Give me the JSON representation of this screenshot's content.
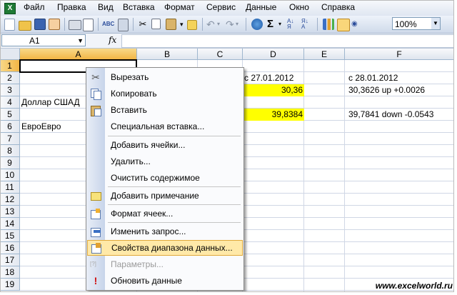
{
  "menubar": {
    "items": [
      "Файл",
      "Правка",
      "Вид",
      "Вставка",
      "Формат",
      "Сервис",
      "Данные",
      "Окно",
      "Справка"
    ]
  },
  "toolbar": {
    "zoom": "100%"
  },
  "formula_bar": {
    "name_box": "A1",
    "fx_label": "fx",
    "formula": ""
  },
  "columns": [
    "A",
    "B",
    "C",
    "D",
    "E",
    "F"
  ],
  "rows": [
    "1",
    "2",
    "3",
    "4",
    "5",
    "6",
    "7",
    "8",
    "9",
    "10",
    "11",
    "12",
    "13",
    "14",
    "15",
    "16",
    "17",
    "18",
    "19"
  ],
  "cells": {
    "D2": "с 27.01.2012",
    "F2": "с 28.01.2012",
    "D3": "30,36",
    "F3": "30,3626 up +0.0026",
    "A4": "Доллар США Доллар США",
    "D5": "39,8384",
    "F5": "39,7841 down -0.0543",
    "A6": "ЕвроЕвро"
  },
  "a4_visible": "Доллар США",
  "a4_tail": "Д",
  "context_menu": {
    "items": [
      {
        "label": "Вырезать",
        "icon": "scissors-icon",
        "enabled": true
      },
      {
        "label": "Копировать",
        "icon": "copy-icon",
        "enabled": true
      },
      {
        "label": "Вставить",
        "icon": "paste-icon",
        "enabled": true
      },
      {
        "label": "Специальная вставка...",
        "icon": "",
        "enabled": true
      },
      {
        "label": "Добавить ячейки...",
        "icon": "",
        "enabled": true
      },
      {
        "label": "Удалить...",
        "icon": "",
        "enabled": true
      },
      {
        "label": "Очистить содержимое",
        "icon": "",
        "enabled": true
      },
      {
        "label": "Добавить примечание",
        "icon": "comment-icon",
        "enabled": true
      },
      {
        "label": "Формат ячеек...",
        "icon": "format-cells-icon",
        "enabled": true
      },
      {
        "label": "Изменить запрос...",
        "icon": "edit-query-icon",
        "enabled": true
      },
      {
        "label": "Свойства диапазона данных...",
        "icon": "data-range-properties-icon",
        "enabled": true,
        "highlighted": true
      },
      {
        "label": "Параметры...",
        "icon": "parameters-icon",
        "enabled": false
      },
      {
        "label": "Обновить данные",
        "icon": "refresh-data-icon",
        "enabled": true
      }
    ]
  },
  "watermark": "www.excelworld.ru",
  "colors": {
    "highlight_cell": "#ffff00",
    "menu_highlight": "#ffe9a8",
    "header_selected": "#f2b545"
  }
}
